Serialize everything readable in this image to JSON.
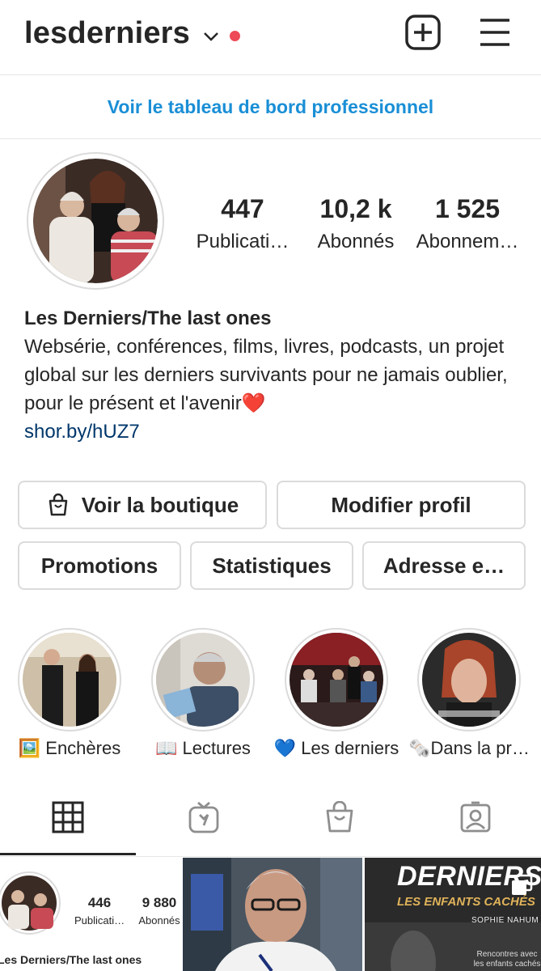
{
  "header": {
    "username": "lesderniers",
    "icons": {
      "account_switch": "chevron-down-icon",
      "notification": "red-dot",
      "create": "plus-square-icon",
      "menu": "hamburger-icon"
    },
    "accent_color": "#ed4956"
  },
  "dashboard_link": "Voir le tableau de bord professionnel",
  "stats": [
    {
      "value": "447",
      "label": "Publicati…"
    },
    {
      "value": "10,2 k",
      "label": "Abonnés"
    },
    {
      "value": "1 525",
      "label": "Abonnem…"
    }
  ],
  "bio": {
    "name": "Les Derniers/The last ones",
    "text": "Websérie, conférences, films, livres, podcasts, un projet global sur les derniers survivants pour ne jamais oublier, pour le présent et l'avenir",
    "emoji": "❤️",
    "link": "shor.by/hUZ7"
  },
  "buttons": {
    "shop": "Voir la boutique",
    "edit_profile": "Modifier profil",
    "promotions": "Promotions",
    "insights": "Statistiques",
    "address": "Adresse e…"
  },
  "highlights": [
    {
      "label": "🖼️ Enchères"
    },
    {
      "label": "📖 Lectures"
    },
    {
      "label": "💙 Les derniers"
    },
    {
      "label": "🗞️Dans la pr…"
    }
  ],
  "tabs": [
    "grid-icon",
    "igtv-icon",
    "shop-bag-icon",
    "tagged-icon"
  ],
  "grid": {
    "post1": {
      "stat1_value": "446",
      "stat1_label": "Publicati…",
      "stat2_value": "9 880",
      "stat2_label": "Abonnés",
      "name": "Les Derniers/The last ones"
    },
    "post3": {
      "title": "DERNIERS",
      "subtitle": "LES ENFANTS CACHÉS",
      "author": "SOPHIE NAHUM",
      "caption_line1": "Rencontres avec",
      "caption_line2": "les enfants cachés"
    }
  }
}
